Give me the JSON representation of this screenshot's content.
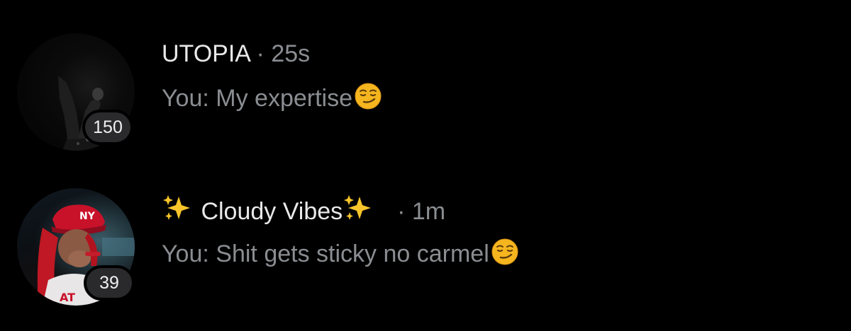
{
  "conversations": [
    {
      "name": "UTOPIA",
      "time": "25s",
      "separator": "·",
      "preview_prefix": "You: ",
      "preview_text": "My expertise",
      "preview_emoji": "smirking-face-icon",
      "unread_count": "150"
    },
    {
      "name": "Cloudy Vibes",
      "name_decorations": "sparkles-icon",
      "time": "1m",
      "separator": "·",
      "preview_prefix": "You: ",
      "preview_text": "Shit gets sticky no carmel",
      "preview_emoji": "smirking-face-icon",
      "unread_count": "39"
    }
  ],
  "colors": {
    "background": "#000000",
    "name_text": "#e9e9ea",
    "secondary_text": "#8a8d91",
    "badge_bg": "#2a2a2c",
    "emoji_yellow": "#f5b51f",
    "sparkle_yellow": "#f7c52b"
  }
}
